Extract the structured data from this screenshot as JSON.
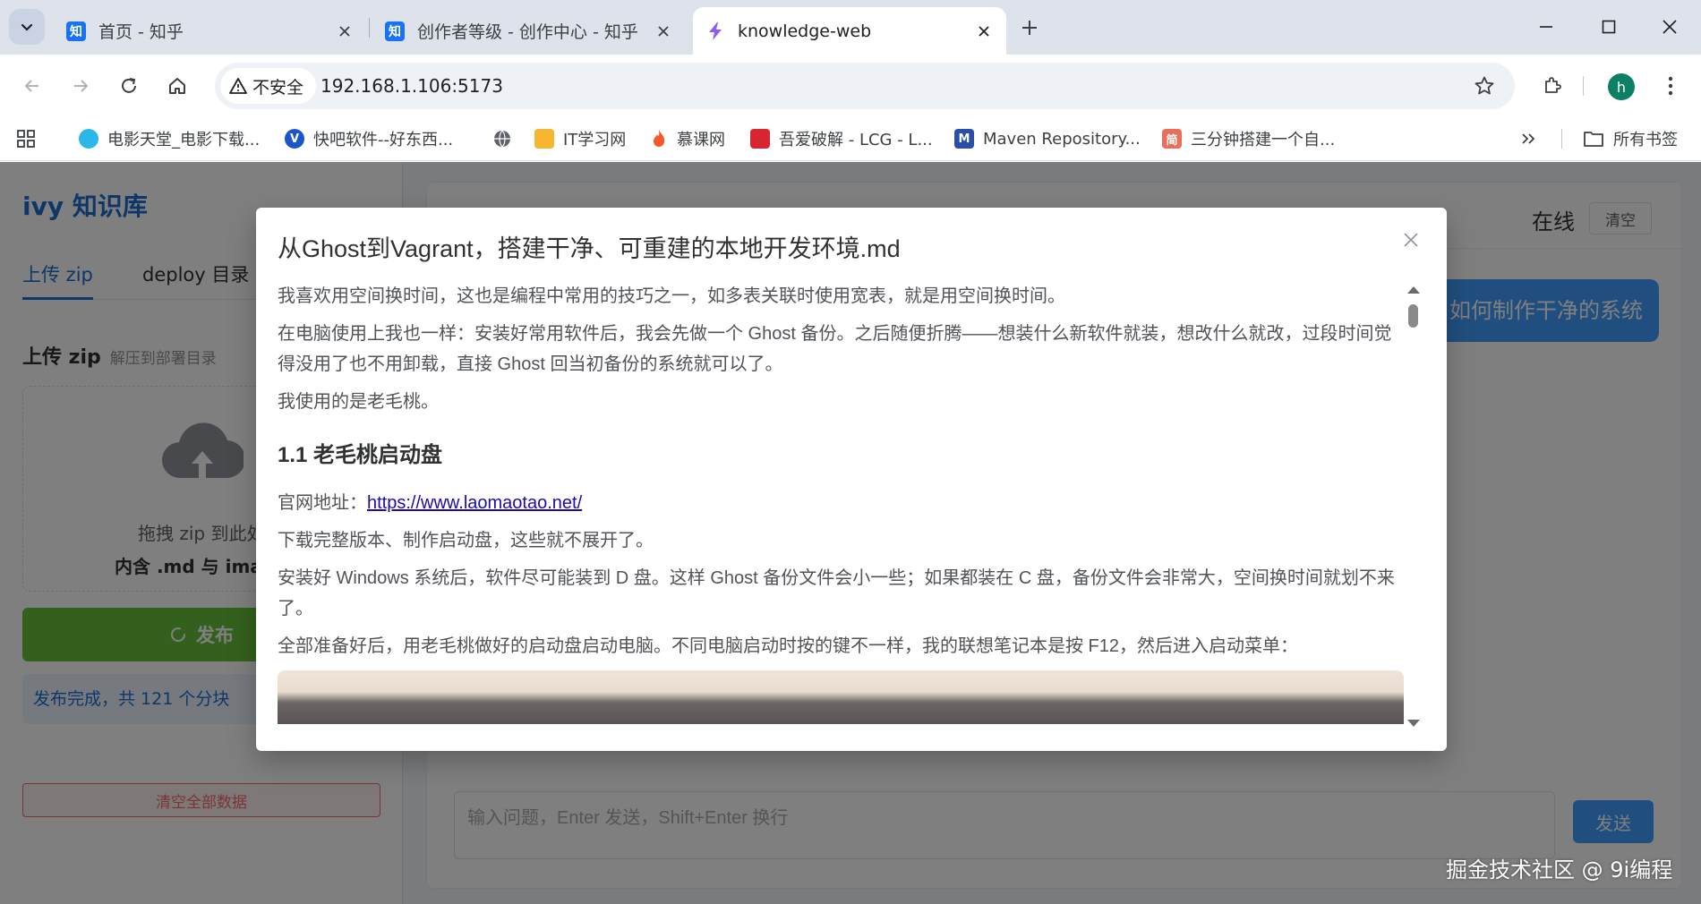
{
  "browser": {
    "tabs": [
      {
        "title": "首页 - 知乎",
        "favicon": "知"
      },
      {
        "title": "创作者等级 - 创作中心 - 知乎",
        "favicon": "知"
      },
      {
        "title": "knowledge-web",
        "favicon": ""
      }
    ],
    "security_label": "不安全",
    "url": "192.168.1.106:5173",
    "profile_initial": "h",
    "bookmarks": [
      {
        "label": "电影天堂_电影下载..."
      },
      {
        "label": "快吧软件--好东西..."
      },
      {
        "label": "IT学习网"
      },
      {
        "label": "慕课网"
      },
      {
        "label": "吾爱破解 - LCG - L..."
      },
      {
        "label": "Maven Repository..."
      },
      {
        "label": "三分钟搭建一个自..."
      }
    ],
    "all_bookmarks_label": "所有书签"
  },
  "app": {
    "brand": "ivy 知识库",
    "tabs": [
      {
        "label": "上传 zip"
      },
      {
        "label": "deploy 目录"
      }
    ],
    "upload": {
      "title": "上传 zip",
      "subtitle": "解压到部署目录",
      "drop_line1": "拖拽 zip 到此处",
      "drop_line2": "内含 .md 与 images"
    },
    "publish_label": "发布",
    "status": "发布完成，共 121 个分块",
    "clear_all_label": "清空全部数据",
    "chat": {
      "online_label": "在线",
      "clear_label": "清空",
      "bubble_text": "如何制作干净的系统",
      "input_placeholder": "输入问题，Enter 发送，Shift+Enter 换行",
      "send_label": "发送"
    }
  },
  "modal": {
    "title": "从Ghost到Vagrant，搭建干净、可重建的本地开发环境.md",
    "paragraphs": [
      "我喜欢用空间换时间，这也是编程中常用的技巧之一，如多表关联时使用宽表，就是用空间换时间。",
      "在电脑使用上我也一样：安装好常用软件后，我会先做一个 Ghost 备份。之后随便折腾——想装什么新软件就装，想改什么就改，过段时间觉得没用了也不用卸载，直接 Ghost 回当初备份的系统就可以了。",
      "我使用的是老毛桃。"
    ],
    "heading": "1.1 老毛桃启动盘",
    "site_label": "官网地址：",
    "site_url": "https://www.laomaotao.net/",
    "paragraphs2": [
      "下载完整版本、制作启动盘，这些就不展开了。",
      "安装好 Windows 系统后，软件尽可能装到 D 盘。这样 Ghost 备份文件会小一些；如果都装在 C 盘，备份文件会非常大，空间换时间就划不来了。",
      "全部准备好后，用老毛桃做好的启动盘启动电脑。不同电脑启动时按的键不一样，我的联想笔记本是按 F12，然后进入启动菜单："
    ]
  },
  "watermark": "掘金技术社区 @ 9i编程"
}
